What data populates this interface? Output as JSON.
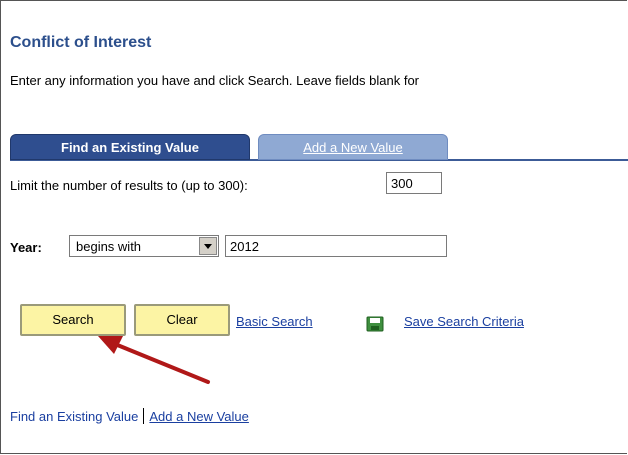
{
  "page": {
    "title": "Conflict of Interest",
    "instructions": "Enter any information you have and click Search. Leave fields blank for"
  },
  "tabs": [
    {
      "label": "Find an Existing Value"
    },
    {
      "label": "Add a New Value"
    }
  ],
  "limit": {
    "label": "Limit the number of results to (up to 300):",
    "value": "300"
  },
  "year": {
    "label": "Year:",
    "operator": "begins with",
    "value": "2012"
  },
  "actions": {
    "search_label": "Search",
    "clear_label": "Clear",
    "basic_search_label": "Basic Search",
    "save_criteria_label": "Save Search Criteria"
  },
  "bottom_links": {
    "find_existing": "Find an Existing Value",
    "add_new": "Add a New Value"
  },
  "colors": {
    "title": "#2c4f8c",
    "tab_active": "#2f4e8f",
    "tab_inactive": "#8fa9d3",
    "button_yellow": "#fcf4a4",
    "annotation_arrow": "#b01818"
  },
  "icons": {
    "save": "save-disk-icon",
    "dropdown": "chevron-down-icon",
    "annotation": "annotation-arrow"
  }
}
